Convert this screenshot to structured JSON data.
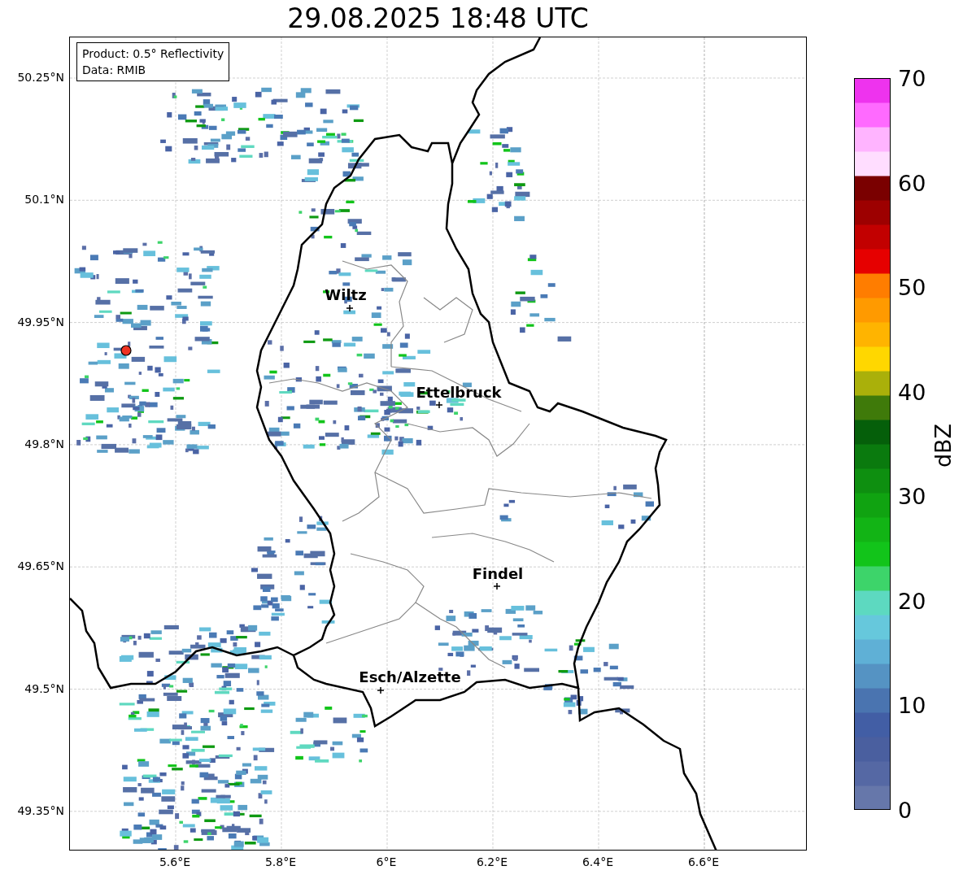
{
  "title": "29.08.2025 18:48 UTC",
  "info_box": [
    "Product: 0.5° Reflectivity",
    "Data: RMIB"
  ],
  "y_ticks": [
    "50.25°N",
    "50.1°N",
    "49.95°N",
    "49.8°N",
    "49.65°N",
    "49.5°N",
    "49.35°N"
  ],
  "x_ticks": [
    "5.6°E",
    "5.8°E",
    "6°E",
    "6.2°E",
    "6.4°E",
    "6.6°E"
  ],
  "cities": [
    {
      "name": "Wiltz"
    },
    {
      "name": "Ettelbruck"
    },
    {
      "name": "Findel"
    },
    {
      "name": "Esch/Alzette"
    }
  ],
  "colorbar": {
    "label": "dBZ",
    "ticks": [
      "70",
      "60",
      "50",
      "40",
      "30",
      "20",
      "10",
      "0"
    ]
  }
}
